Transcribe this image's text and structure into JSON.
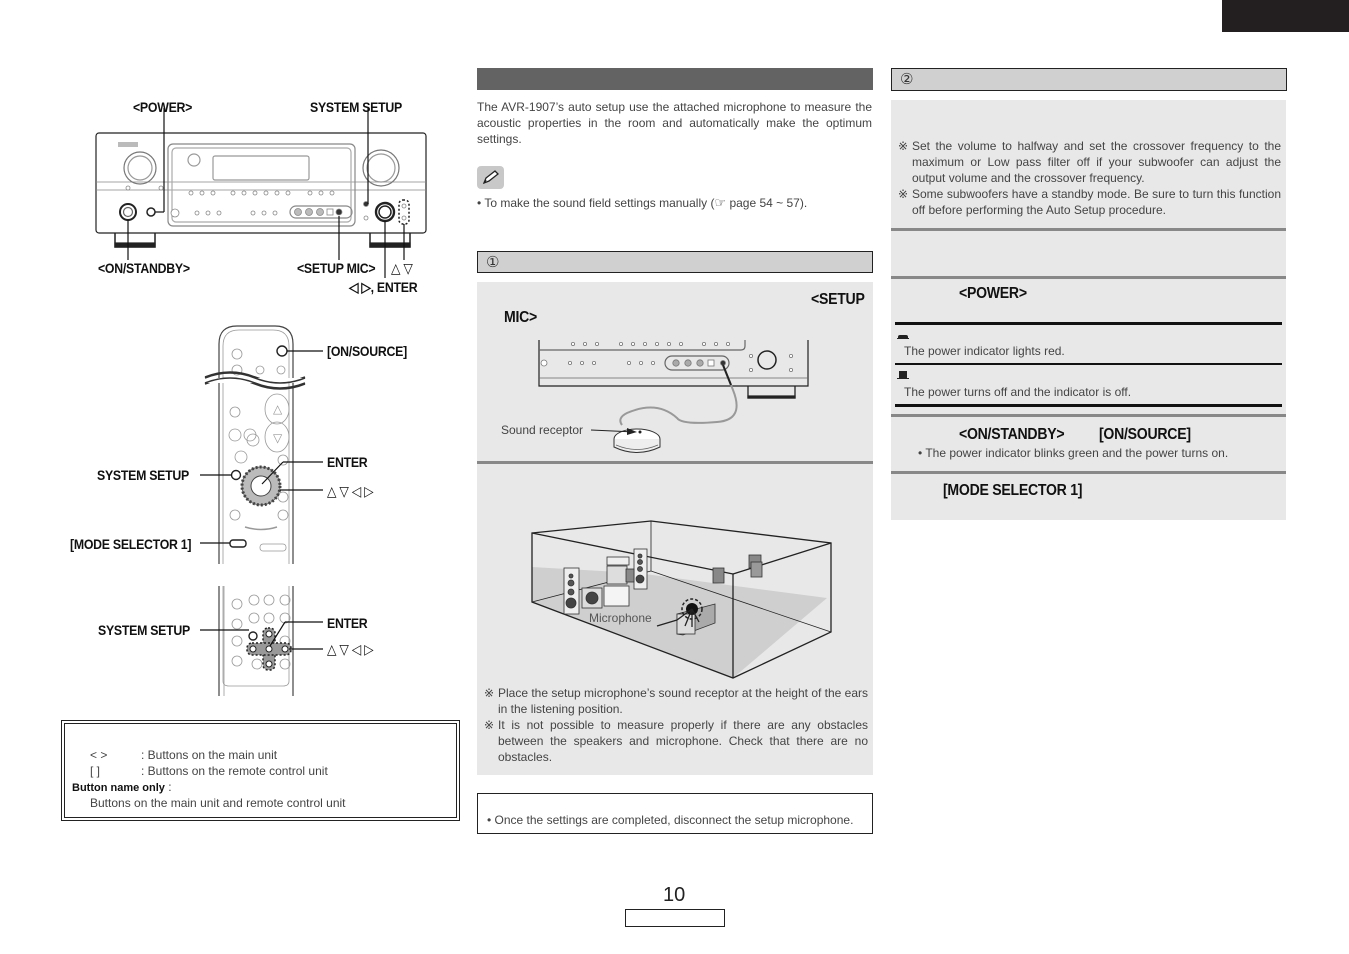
{
  "page": {
    "page_number": "10",
    "corner_tab_color": "#231f20"
  },
  "left": {
    "main_unit_labels": {
      "power": "<POWER>",
      "system_setup": "SYSTEM SETUP",
      "on_standby": "<ON/STANDBY>",
      "setup_mic": "<SETUP MIC>",
      "up_down": "△ ▽",
      "left_right_enter": "◁ ▷, ENTER"
    },
    "remote1_labels": {
      "on_source": "[ON/SOURCE]",
      "enter": "ENTER",
      "system_setup": "SYSTEM SETUP",
      "arrows": "△ ▽ ◁ ▷",
      "mode_selector": "[MODE SELECTOR 1]"
    },
    "remote2_labels": {
      "system_setup": "SYSTEM SETUP",
      "enter": "ENTER",
      "arrows": "△ ▽ ◁ ▷"
    },
    "legend": {
      "angle_symbol": "<      >",
      "angle_desc": ": Buttons on the main unit",
      "bracket_symbol": "[      ]",
      "bracket_desc": ": Buttons on the remote control unit",
      "name_only_label": "Button name only",
      "name_only_colon": " :",
      "name_only_desc": "Buttons on the main unit and remote control unit"
    }
  },
  "middle": {
    "intro": "The AVR-1907’s auto setup use the attached microphone to measure the acoustic properties in the room and automatically make the optimum settings.",
    "note_icon": "pencil-icon",
    "manual_note_prefix": "• To make the sound field settings manually (",
    "manual_note_ref_icon": "☞",
    "manual_note_suffix": " page 54 ~ 57).",
    "step1_number": "①",
    "step1_setup": "<SETUP",
    "step1_mic": "MIC>",
    "sound_receptor_label": "Sound receptor",
    "microphone_label": "Microphone",
    "notes": [
      "Place the setup microphone’s sound receptor at the height of the ears in the listening position.",
      "It is not possible to measure properly if there are any obstacles between the speakers and microphone. Check that there are no obstacles."
    ],
    "note_mark": "※",
    "bottom_note": "• Once the settings are completed, disconnect the setup microphone."
  },
  "right": {
    "step2_number": "②",
    "notes": [
      "Set the volume to halfway and set the crossover frequency to the maximum or Low pass filter off if your subwoofer can adjust the output volume and the crossover frequency.",
      "Some subwoofers have a standby mode. Be sure to turn this function off before performing the Auto Setup procedure."
    ],
    "note_mark": "※",
    "power_label": "<POWER>",
    "power_on_desc": "The power indicator lights red.",
    "power_off_desc": "The power turns off and the indicator is off.",
    "on_standby_label": "<ON/STANDBY>",
    "on_source_label": "[ON/SOURCE]",
    "on_note": "• The power indicator blinks green and the power turns on.",
    "mode_selector_label": "[MODE SELECTOR 1]"
  }
}
